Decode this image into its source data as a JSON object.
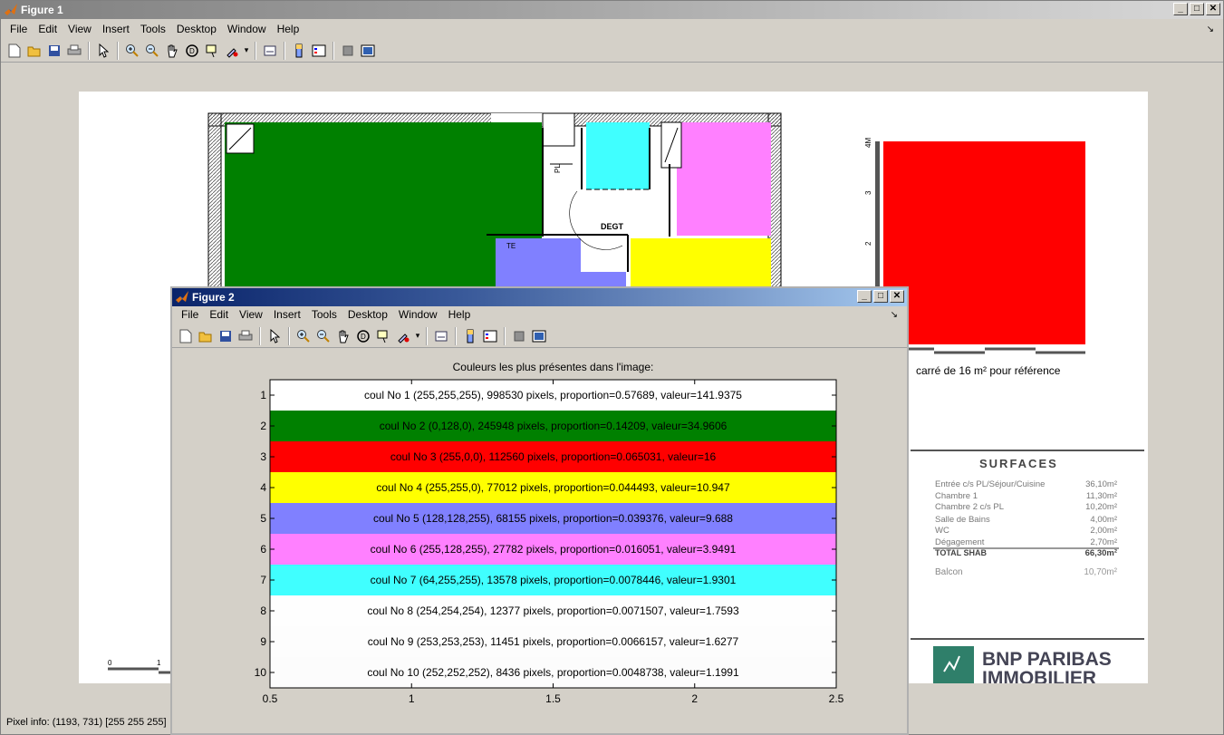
{
  "figure1": {
    "title": "Figure 1",
    "menu": [
      "File",
      "Edit",
      "View",
      "Insert",
      "Tools",
      "Desktop",
      "Window",
      "Help"
    ],
    "status": "Pixel info: (1193, 731)  [255 255 255]",
    "plan": {
      "room_label_dect": "DEGT",
      "room_label_pl": "PL",
      "room_label_te": "TE",
      "ref_caption": "carré de 16 m² pour référence",
      "ruler_ticks": [
        "4M",
        "3",
        "2"
      ],
      "scale_ticks": [
        "0",
        "1"
      ],
      "surfaces_title": "SURFACES",
      "surfaces": [
        {
          "label": "Entrée c/s PL/Séjour/Cuisine",
          "value": "36,10m²"
        },
        {
          "label": "Chambre 1",
          "value": "11,30m²"
        },
        {
          "label": "Chambre 2 c/s PL",
          "value": "10,20m²"
        },
        {
          "label": "Salle de Bains",
          "value": "4,00m²"
        },
        {
          "label": "WC",
          "value": "2,00m²"
        },
        {
          "label": "Dégagement",
          "value": "2,70m²"
        }
      ],
      "total_label": "TOTAL SHAB",
      "total_value": "66,30m²",
      "balcon_label": "Balcon",
      "balcon_value": "10,70m²",
      "logo_text_1": "BNP PARIBAS",
      "logo_text_2": "IMMOBILIER"
    }
  },
  "figure2": {
    "title": "Figure 2",
    "menu": [
      "File",
      "Edit",
      "View",
      "Insert",
      "Tools",
      "Desktop",
      "Window",
      "Help"
    ]
  },
  "colors": {
    "c1": "#ffffff",
    "c2": "#008000",
    "c3": "#ff0000",
    "c4": "#ffff00",
    "c5": "#8080ff",
    "c6": "#ff80ff",
    "c7": "#40ffff",
    "c8": "#fefefe",
    "c9": "#fdfdfd",
    "c10": "#fcfcfc"
  },
  "chart_data": {
    "type": "bar",
    "orientation": "horizontal",
    "title": "Couleurs les plus présentes dans l'image:",
    "xlim": [
      0.5,
      2.5
    ],
    "ylim": [
      0.5,
      10.5
    ],
    "x_ticks": [
      "0.5",
      "1",
      "1.5",
      "2",
      "2.5"
    ],
    "y_ticks": [
      "1",
      "2",
      "3",
      "4",
      "5",
      "6",
      "7",
      "8",
      "9",
      "10"
    ],
    "bars": [
      {
        "y": 1,
        "color": "#ffffff",
        "label": "coul No 1 (255,255,255), 998530 pixels, proportion=0.57689, valeur=141.9375"
      },
      {
        "y": 2,
        "color": "#008000",
        "label": "coul No 2 (0,128,0), 245948 pixels, proportion=0.14209, valeur=34.9606"
      },
      {
        "y": 3,
        "color": "#ff0000",
        "label": "coul No 3 (255,0,0), 112560 pixels, proportion=0.065031, valeur=16"
      },
      {
        "y": 4,
        "color": "#ffff00",
        "label": "coul No 4 (255,255,0), 77012 pixels, proportion=0.044493, valeur=10.947"
      },
      {
        "y": 5,
        "color": "#8080ff",
        "label": "coul No 5 (128,128,255), 68155 pixels, proportion=0.039376, valeur=9.688"
      },
      {
        "y": 6,
        "color": "#ff80ff",
        "label": "coul No 6 (255,128,255), 27782 pixels, proportion=0.016051, valeur=3.9491"
      },
      {
        "y": 7,
        "color": "#40ffff",
        "label": "coul No 7 (64,255,255), 13578 pixels, proportion=0.0078446, valeur=1.9301"
      },
      {
        "y": 8,
        "color": "#fefefe",
        "label": "coul No 8 (254,254,254), 12377 pixels, proportion=0.0071507, valeur=1.7593"
      },
      {
        "y": 9,
        "color": "#fdfdfd",
        "label": "coul No 9 (253,253,253), 11451 pixels, proportion=0.0066157, valeur=1.6277"
      },
      {
        "y": 10,
        "color": "#fcfcfc",
        "label": "coul No 10 (252,252,252), 8436 pixels, proportion=0.0048738, valeur=1.1991"
      }
    ]
  }
}
